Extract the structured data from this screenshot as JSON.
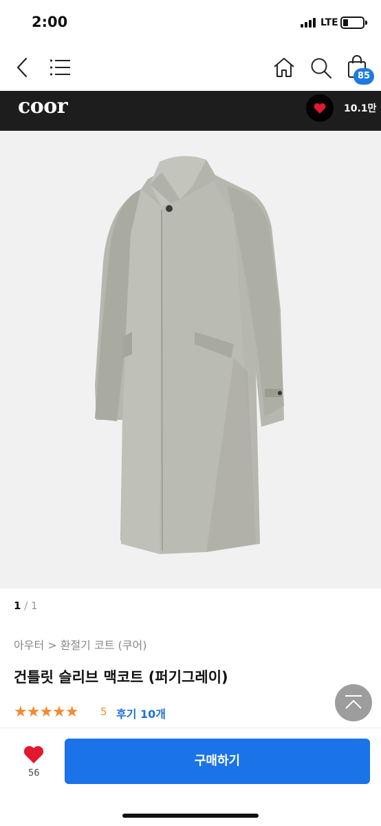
{
  "status_bar": {
    "time": "2:00",
    "network": "LTE"
  },
  "nav": {
    "icons": [
      "back-icon",
      "menu-icon",
      "home-icon",
      "search-icon",
      "shopping-bag-icon"
    ],
    "cart_count": "85"
  },
  "brand": {
    "name": "coor",
    "likes": "10.1만"
  },
  "gallery": {
    "current": "1",
    "total": "/ 1"
  },
  "product": {
    "breadcrumb": "아우터 > 환절기 코트 (쿠어)",
    "title": "건틀릿 슬리브 맥코트 (퍼기그레이)",
    "stars": "★★★★★",
    "rating": "5",
    "reviews": "후기 10개"
  },
  "bottom": {
    "wish_count": "56",
    "buy_label": "구매하기"
  },
  "colors": {
    "accent_blue": "#1a73e8",
    "badge_blue": "#1f7ae0",
    "heart_red": "#e3172e",
    "star_orange": "#f5892c",
    "brand_bar": "#1d1d1d"
  }
}
